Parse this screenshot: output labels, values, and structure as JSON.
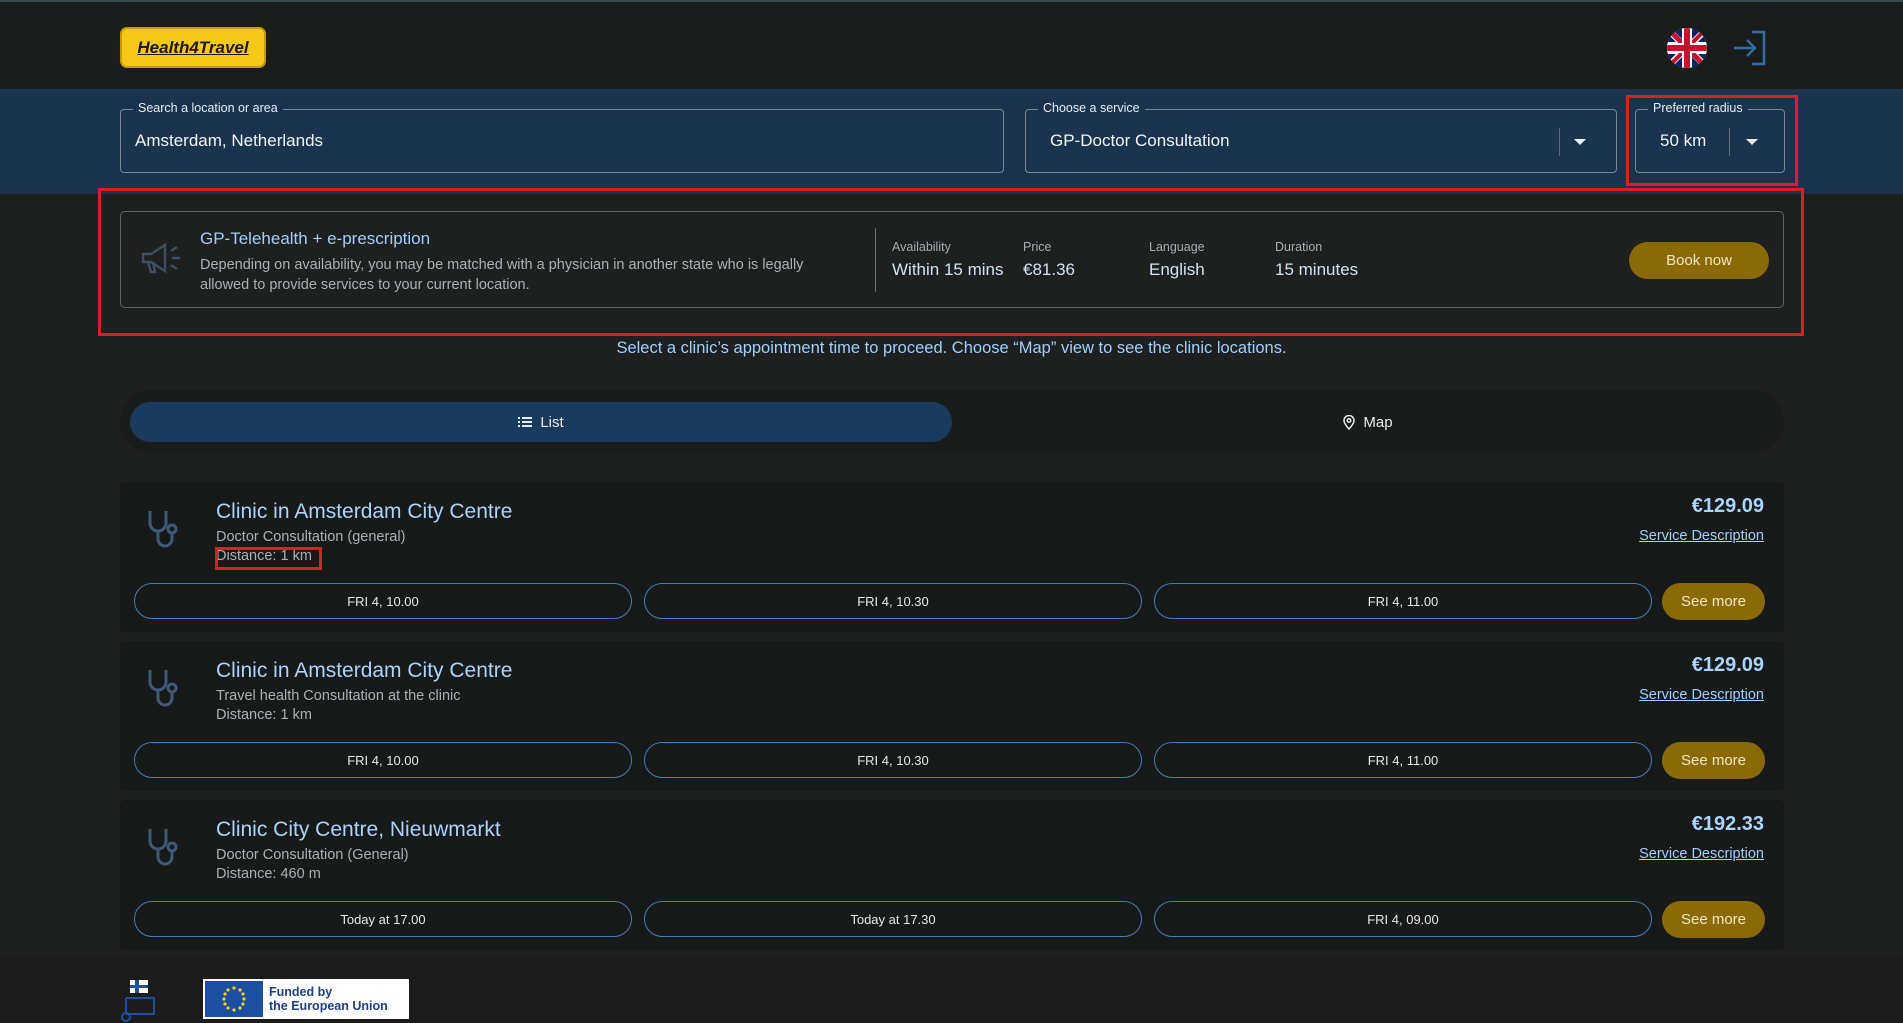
{
  "header": {
    "logo_text": "Health4Travel",
    "language_icon": "uk-flag-icon",
    "login_icon": "sign-in-icon"
  },
  "search": {
    "location_label": "Search a location or area",
    "location_value": "Amsterdam, Netherlands",
    "service_label": "Choose a service",
    "service_value": "GP-Doctor Consultation",
    "radius_label": "Preferred radius",
    "radius_value": "50 km"
  },
  "telehealth": {
    "title": "GP-Telehealth + e-prescription",
    "description": "Depending on availability, you may be matched with a physician in another state who is legally allowed to provide services to your current location.",
    "availability_label": "Availability",
    "availability_value": "Within 15 mins",
    "price_label": "Price",
    "price_value": "€81.36",
    "language_label": "Language",
    "language_value": "English",
    "duration_label": "Duration",
    "duration_value": "15 minutes",
    "book_label": "Book now"
  },
  "hint": "Select a clinic’s appointment time to proceed. Choose “Map” view to see the clinic locations.",
  "view_toggle": {
    "list_label": "List",
    "map_label": "Map"
  },
  "clinics": [
    {
      "name": "Clinic in Amsterdam City Centre",
      "service": "Doctor Consultation (general)",
      "distance": "Distance: 1 km",
      "price": "€129.09",
      "service_description": "Service Description",
      "slots": [
        "FRI 4, 10.00",
        "FRI 4, 10.30",
        "FRI 4, 11.00"
      ],
      "see_more": "See more"
    },
    {
      "name": "Clinic in Amsterdam City Centre",
      "service": "Travel health Consultation at the clinic",
      "distance": "Distance: 1 km",
      "price": "€129.09",
      "service_description": "Service Description",
      "slots": [
        "FRI 4, 10.00",
        "FRI 4, 10.30",
        "FRI 4, 11.00"
      ],
      "see_more": "See more"
    },
    {
      "name": "Clinic City Centre, Nieuwmarkt",
      "service": "Doctor Consultation (General)",
      "distance": "Distance: 460 m",
      "price": "€192.33",
      "service_description": "Service Description",
      "slots": [
        "Today at 17.00",
        "Today at 17.30",
        "FRI 4, 09.00"
      ],
      "see_more": "See more"
    }
  ],
  "footer": {
    "eu_text_line1": "Funded by",
    "eu_text_line2": "the European Union"
  },
  "colors": {
    "accent_gold": "#8a6a06",
    "band_blue": "#1a3450",
    "link_blue": "#a8d4ff",
    "highlight_red": "#e21c24"
  }
}
